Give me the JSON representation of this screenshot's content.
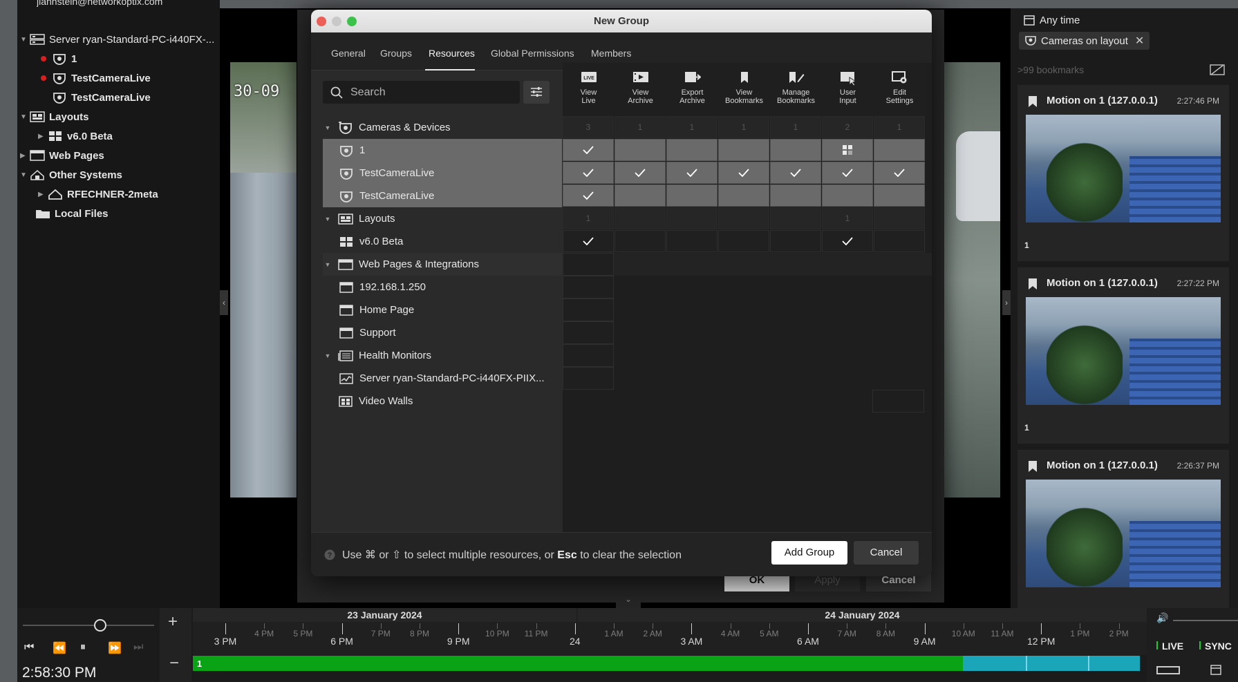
{
  "app": {
    "user_email": "jlahnstein@networkoptix.com",
    "tree": [
      {
        "label": "Server ryan-Standard-PC-i440FX-...",
        "icon": "server-icon"
      },
      {
        "label": "1",
        "icon": "camera-icon",
        "recording": true
      },
      {
        "label": "TestCameraLive",
        "icon": "camera-icon",
        "recording": true
      },
      {
        "label": "TestCameraLive",
        "icon": "camera-icon",
        "recording": false
      },
      {
        "label": "Layouts",
        "icon": "layouts-icon"
      },
      {
        "label": "v6.0 Beta",
        "icon": "layout-icon"
      },
      {
        "label": "Web Pages",
        "icon": "webpages-icon"
      },
      {
        "label": "Other Systems",
        "icon": "other-systems-icon"
      },
      {
        "label": "RFECHNER-2meta",
        "icon": "system-icon"
      },
      {
        "label": "Local Files",
        "icon": "folder-icon"
      }
    ],
    "video_overlay_text": "30-09"
  },
  "right_panel": {
    "time_filter": "Any time",
    "cameras_filter": "Cameras on layout",
    "bookmarks_count": ">99 bookmarks",
    "bookmarks": [
      {
        "title": "Motion on 1 (127.0.0.1)",
        "time": "2:27:46 PM",
        "camera": "1"
      },
      {
        "title": "Motion on 1 (127.0.0.1)",
        "time": "2:27:22 PM",
        "camera": "1"
      },
      {
        "title": "Motion on 1 (127.0.0.1)",
        "time": "2:26:37 PM",
        "camera": "1"
      }
    ]
  },
  "behind_dialog": {
    "ok": "OK",
    "apply": "Apply",
    "cancel": "Cancel"
  },
  "dialog": {
    "title": "New Group",
    "tabs": [
      "General",
      "Groups",
      "Resources",
      "Global Permissions",
      "Members"
    ],
    "active_tab": "Resources",
    "search_placeholder": "Search",
    "permission_columns": [
      {
        "label1": "View",
        "label2": "Live",
        "icon": "view-live-icon"
      },
      {
        "label1": "View",
        "label2": "Archive",
        "icon": "view-archive-icon"
      },
      {
        "label1": "Export",
        "label2": "Archive",
        "icon": "export-archive-icon"
      },
      {
        "label1": "View",
        "label2": "Bookmarks",
        "icon": "view-bookmarks-icon"
      },
      {
        "label1": "Manage",
        "label2": "Bookmarks",
        "icon": "manage-bookmarks-icon"
      },
      {
        "label1": "User",
        "label2": "Input",
        "icon": "user-input-icon"
      },
      {
        "label1": "Edit",
        "label2": "Settings",
        "icon": "edit-settings-icon"
      }
    ],
    "groups": {
      "cameras": {
        "label": "Cameras & Devices",
        "counts": [
          "3",
          "1",
          "1",
          "1",
          "1",
          "2",
          "1"
        ],
        "items": [
          {
            "label": "1",
            "perms": [
              "check",
              "",
              "",
              "",
              "",
              "partial",
              ""
            ]
          },
          {
            "label": "TestCameraLive",
            "perms": [
              "check",
              "check",
              "check",
              "check",
              "check",
              "check",
              "check"
            ]
          },
          {
            "label": "TestCameraLive",
            "perms": [
              "check",
              "",
              "",
              "",
              "",
              "",
              ""
            ]
          }
        ]
      },
      "layouts": {
        "label": "Layouts",
        "counts": [
          "1",
          "",
          "",
          "",
          "",
          "1",
          ""
        ],
        "items": [
          {
            "label": "v6.0 Beta",
            "perms": [
              "check",
              "",
              "",
              "",
              "",
              "check",
              ""
            ]
          }
        ]
      },
      "web_pages": {
        "label": "Web Pages & Integrations",
        "items": [
          {
            "label": "192.168.1.250"
          },
          {
            "label": "Home Page"
          },
          {
            "label": "Support"
          }
        ]
      },
      "health": {
        "label": "Health Monitors",
        "items": [
          {
            "label": "Server ryan-Standard-PC-i440FX-PIIX..."
          }
        ]
      },
      "video_walls": {
        "label": "Video Walls"
      }
    },
    "hint": {
      "prefix": "Use ⌘ or ⇧ to select multiple resources, or",
      "key": "Esc",
      "suffix": "to clear the selection"
    },
    "add_button": "Add Group",
    "cancel_button": "Cancel"
  },
  "timeline": {
    "date_left": "23 January 2024",
    "date_right": "24 January 2024",
    "ticks": [
      "3 PM",
      "4 PM",
      "5 PM",
      "6 PM",
      "7 PM",
      "8 PM",
      "9 PM",
      "10 PM",
      "11 PM",
      "24",
      "1 AM",
      "2 AM",
      "3 AM",
      "4 AM",
      "5 AM",
      "6 AM",
      "7 AM",
      "8 AM",
      "9 AM",
      "10 AM",
      "11 AM",
      "12 PM",
      "1 PM",
      "2 PM"
    ],
    "major_ticks": [
      "3 PM",
      "6 PM",
      "9 PM",
      "24",
      "3 AM",
      "6 AM",
      "9 AM",
      "12 PM"
    ],
    "camera_track_label": "1",
    "clock": "2:58:30 PM",
    "live": "LIVE",
    "sync": "SYNC"
  }
}
